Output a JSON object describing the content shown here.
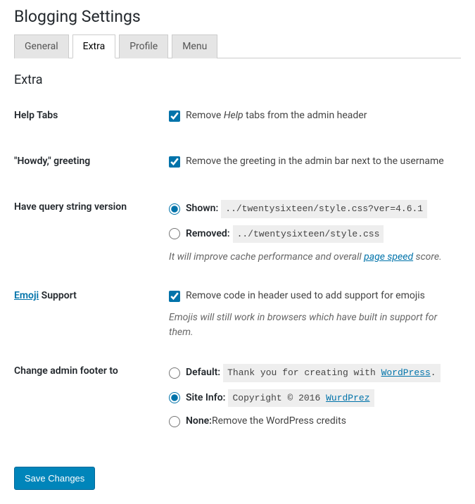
{
  "page_title": "Blogging Settings",
  "tabs": [
    {
      "label": "General",
      "active": false
    },
    {
      "label": "Extra",
      "active": true
    },
    {
      "label": "Profile",
      "active": false
    },
    {
      "label": "Menu",
      "active": false
    }
  ],
  "section_heading": "Extra",
  "rows": {
    "help_tabs": {
      "label": "Help Tabs",
      "checkbox_prefix": "Remove ",
      "checkbox_italic": "Help",
      "checkbox_suffix": " tabs from the admin header"
    },
    "howdy": {
      "label": "\"Howdy,\" greeting",
      "checkbox_text": "Remove the greeting in the admin bar next to the username"
    },
    "query_string": {
      "label": "Have query string version",
      "shown_label": "Shown:",
      "shown_code": "../twentysixteen/style.css?ver=4.6.1",
      "removed_label": "Removed:",
      "removed_code": "../twentysixteen/style.css",
      "desc_prefix": "It will improve cache performance and overall ",
      "desc_link": "page speed",
      "desc_suffix": " score."
    },
    "emoji": {
      "label_link": "Emoji",
      "label_suffix": " Support",
      "checkbox_text": "Remove code in header used to add support for emojis",
      "desc": "Emojis will still work in browsers which have built in support for them."
    },
    "footer": {
      "label": "Change admin footer to",
      "default_label": "Default:",
      "default_code_prefix": "Thank you for creating with ",
      "default_code_link": "WordPress",
      "default_code_suffix": ".",
      "siteinfo_label": "Site Info:",
      "siteinfo_code_prefix": "Copyright © 2016 ",
      "siteinfo_code_link": "WurdPrez",
      "none_label": "None:",
      "none_text": " Remove the WordPress credits"
    }
  },
  "save_button": "Save Changes"
}
